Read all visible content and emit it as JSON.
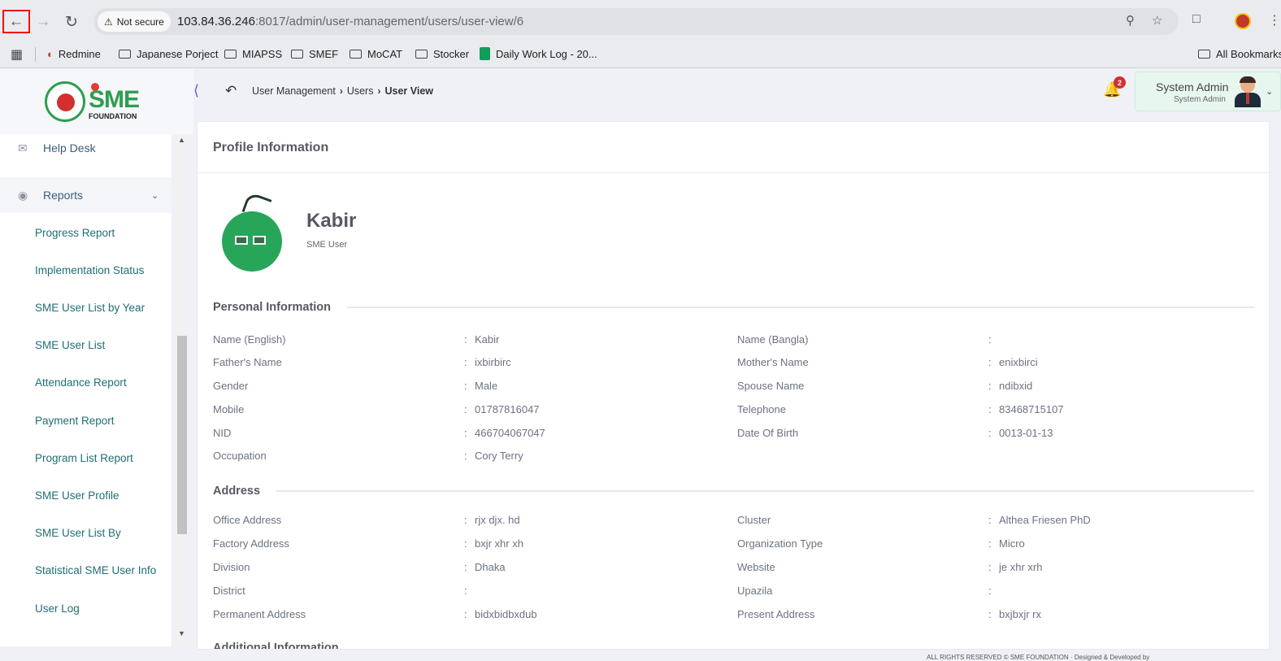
{
  "browser": {
    "security_label": "Not secure",
    "url_host": "103.84.36.246",
    "url_rest": ":8017/admin/user-management/users/user-view/6",
    "bookmarks": [
      "Redmine",
      "Japanese Porject",
      "MIAPSS",
      "SMEF",
      "MoCAT",
      "Stocker",
      "Daily Work Log - 20...",
      "All Bookmarks"
    ]
  },
  "brand": {
    "logo_text": "SME",
    "logo_sub": "FOUNDATION"
  },
  "sidebar": {
    "groups": [
      "Help Desk",
      "Reports"
    ],
    "items": [
      "Progress Report",
      "Implementation Status",
      "SME User List by Year",
      "SME User List",
      "Attendance Report",
      "Payment Report",
      "Program List Report",
      "SME User Profile",
      "SME User List By",
      "Statistical SME User Info",
      "User Log"
    ]
  },
  "breadcrumb": {
    "items": [
      "User Management",
      "Users",
      "User View"
    ]
  },
  "header": {
    "notification_count": "2",
    "user_name": "System Admin",
    "user_role": "System Admin"
  },
  "profile": {
    "card_title": "Profile Information",
    "name": "Kabir",
    "role": "SME User"
  },
  "personal": {
    "title": "Personal Information",
    "left": [
      {
        "label": "Name (English)",
        "value": "Kabir"
      },
      {
        "label": "Father's Name",
        "value": "ixbirbirc"
      },
      {
        "label": "Gender",
        "value": "Male"
      },
      {
        "label": "Mobile",
        "value": "01787816047"
      },
      {
        "label": "NID",
        "value": "466704067047"
      },
      {
        "label": "Occupation",
        "value": "Cory Terry"
      }
    ],
    "right": [
      {
        "label": "Name (Bangla)",
        "value": ""
      },
      {
        "label": "Mother's Name",
        "value": "enixbirci"
      },
      {
        "label": "Spouse Name",
        "value": "ndibxid"
      },
      {
        "label": "Telephone",
        "value": "83468715107"
      },
      {
        "label": "Date Of Birth",
        "value": "0013-01-13"
      }
    ]
  },
  "address": {
    "title": "Address",
    "left": [
      {
        "label": "Office Address",
        "value": "rjx djx. hd"
      },
      {
        "label": "Factory Address",
        "value": "bxjr xhr xh"
      },
      {
        "label": "Division",
        "value": "Dhaka"
      },
      {
        "label": "District",
        "value": ""
      },
      {
        "label": "Permanent Address",
        "value": "bidxbidbxdub"
      }
    ],
    "right": [
      {
        "label": "Cluster",
        "value": "Althea Friesen PhD"
      },
      {
        "label": "Organization Type",
        "value": "Micro"
      },
      {
        "label": "Website",
        "value": "je xhr xrh"
      },
      {
        "label": "Upazila",
        "value": ""
      },
      {
        "label": "Present Address",
        "value": "bxjbxjr rx"
      }
    ]
  },
  "additional": {
    "title": "Additional Information"
  },
  "footer": {
    "text": "ALL RIGHTS RESERVED © SME FOUNDATION · Designed & Developed by"
  }
}
